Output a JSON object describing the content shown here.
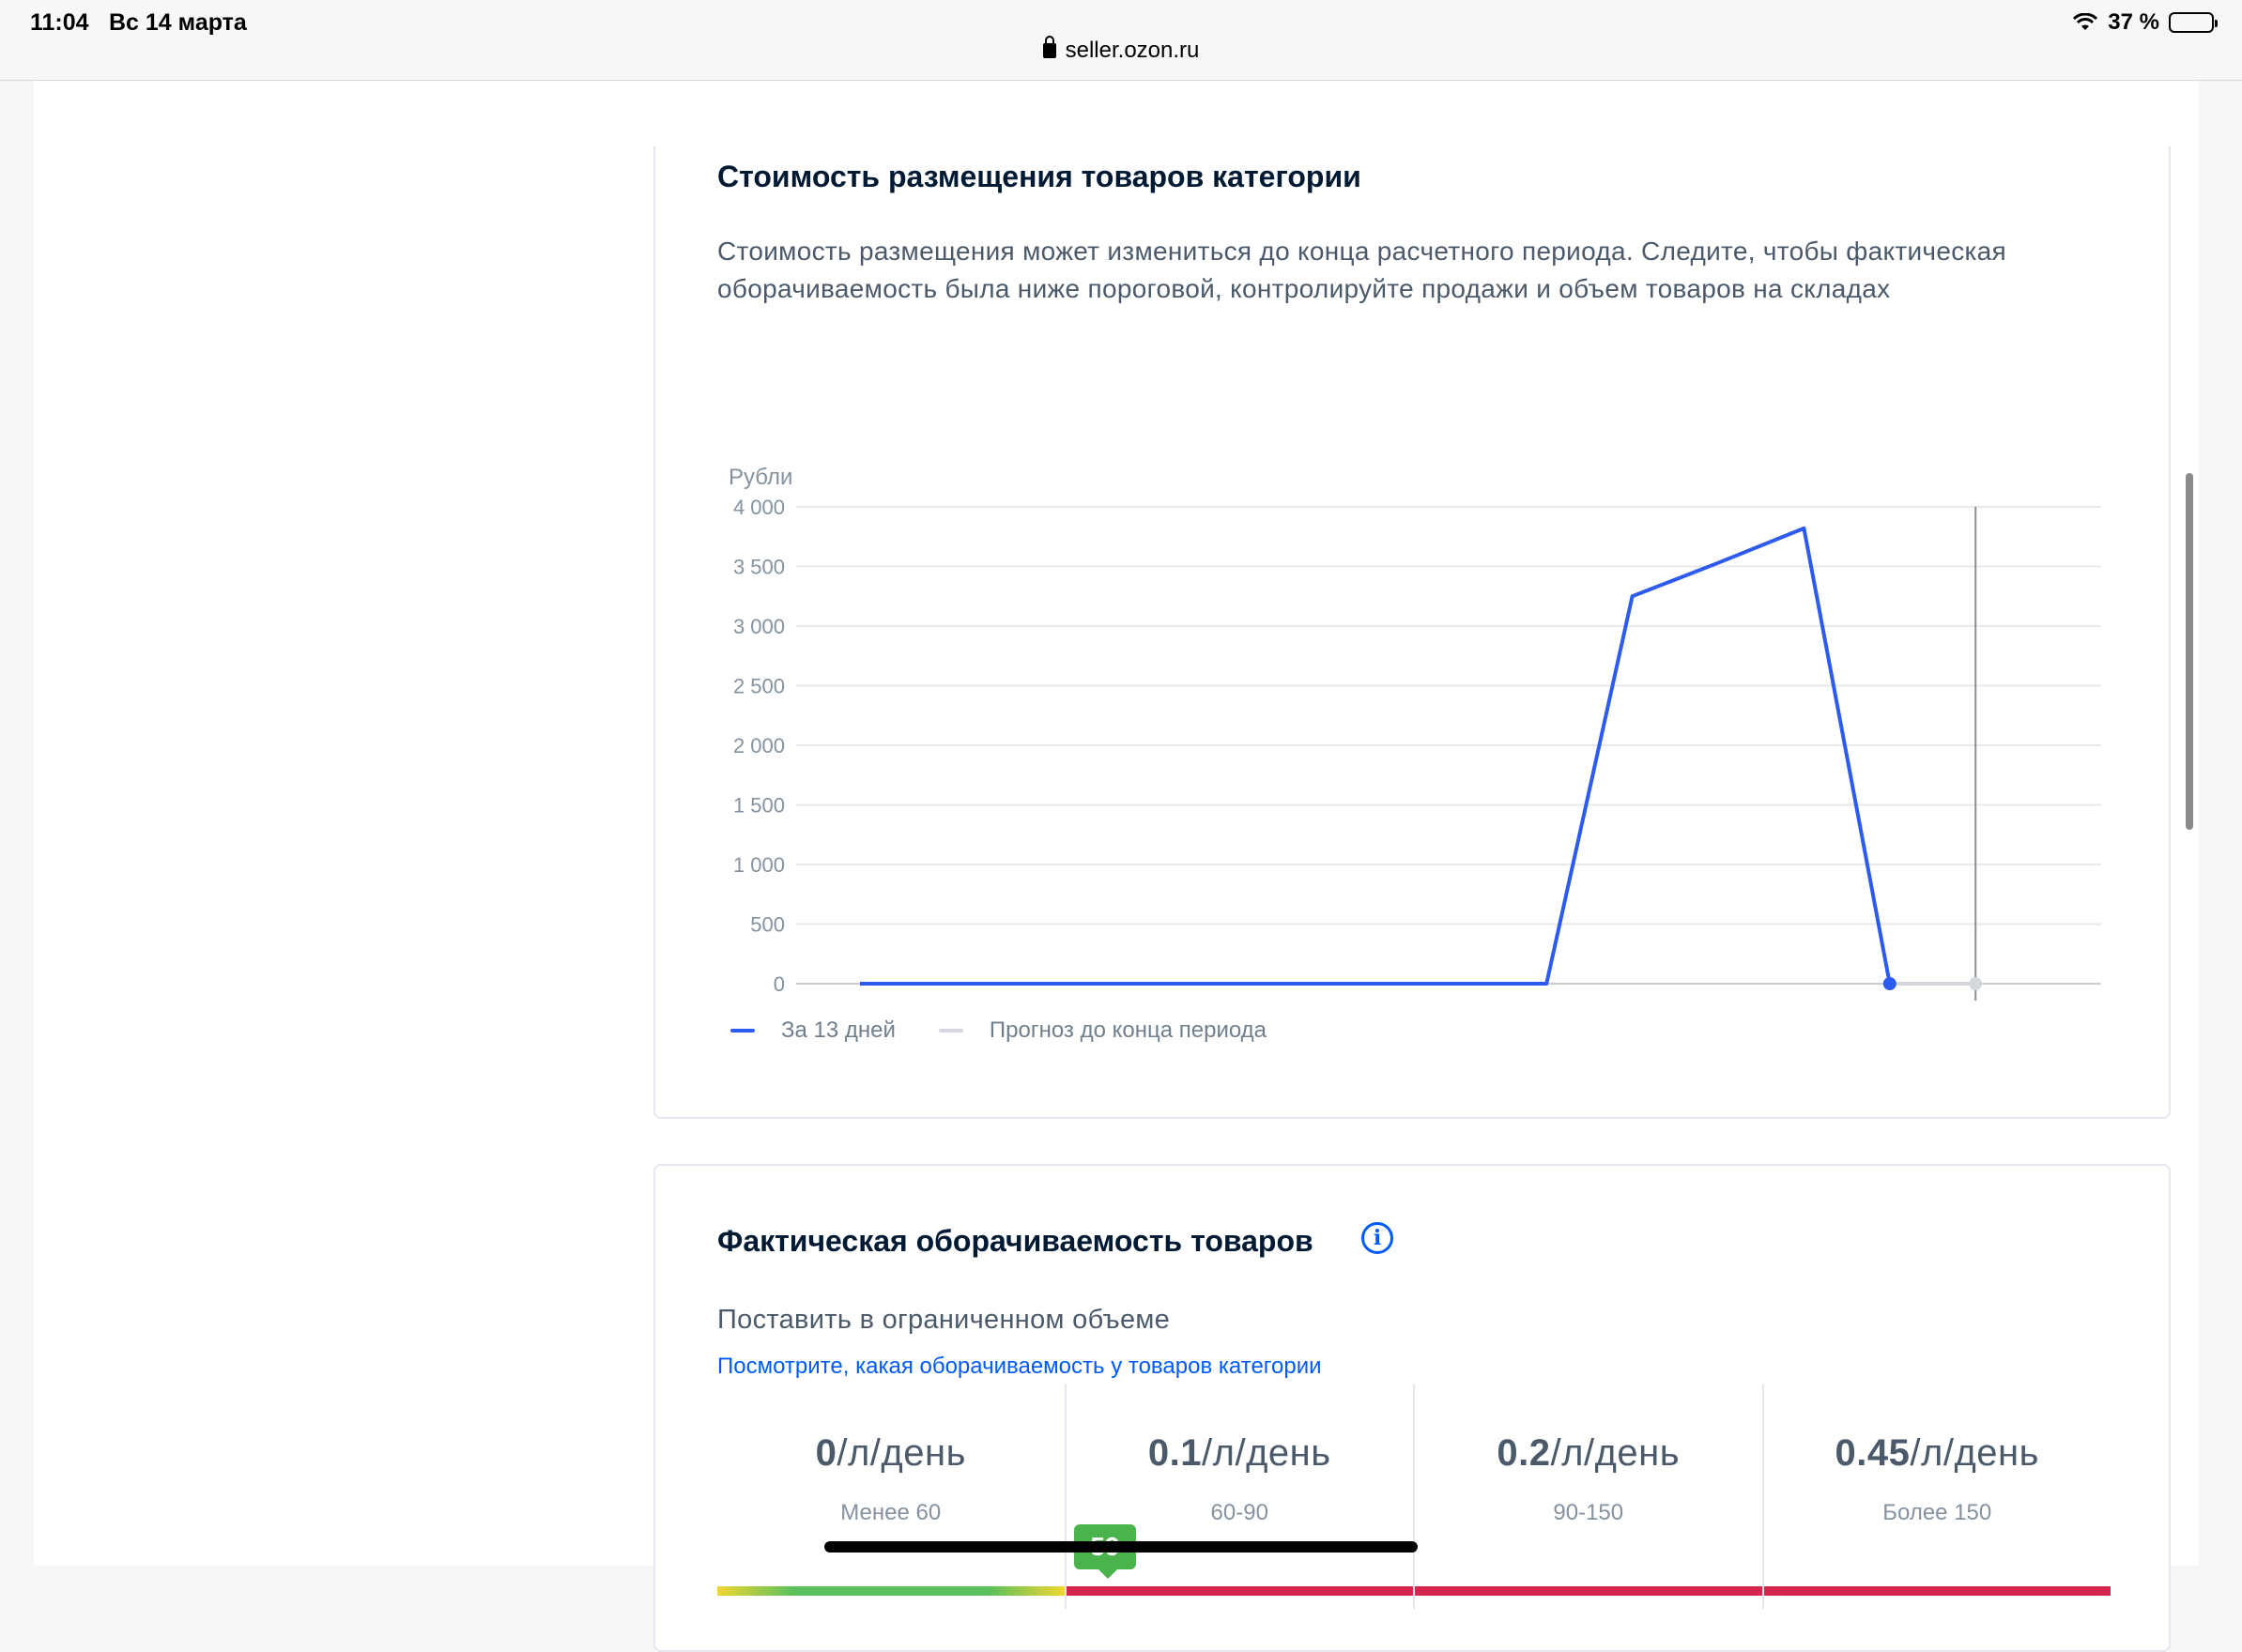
{
  "statusbar": {
    "time": "11:04",
    "date": "Вс 14 марта",
    "url": "seller.ozon.ru",
    "battery": "37 %"
  },
  "placement": {
    "title": "Стоимость размещения товаров категории",
    "description": "Стоимость размещения может измениться до конца расчетного периода. Следите, чтобы фактическая оборачиваемость была ниже пороговой, контролируйте продажи и объем товаров на складах",
    "legend": {
      "actual": "За 13 дней",
      "forecast": "Прогноз до конца периода"
    },
    "current_label": "0 ₽",
    "forecast_label": "0 ₽"
  },
  "chart_data": {
    "type": "line",
    "ylabel": "Рубли",
    "ylim": [
      0,
      4000
    ],
    "yticks": [
      0,
      500,
      1000,
      1500,
      2000,
      2500,
      3000,
      3500,
      4000
    ],
    "ytick_labels": [
      "0",
      "500",
      "1 000",
      "1 500",
      "2 000",
      "2 500",
      "3 000",
      "3 500",
      "4 000"
    ],
    "x": [
      "1",
      "2",
      "3",
      "4",
      "5",
      "6",
      "7",
      "8",
      "9",
      "10",
      "11",
      "12",
      "13",
      "14",
      "15"
    ],
    "series": [
      {
        "name": "За 13 дней",
        "color": "#2d5bef",
        "x": [
          1,
          2,
          3,
          4,
          5,
          6,
          7,
          8,
          9,
          10,
          11,
          12,
          13
        ],
        "values": [
          0,
          0,
          0,
          0,
          0,
          0,
          0,
          0,
          0,
          3250,
          3530,
          3820,
          0
        ]
      },
      {
        "name": "Прогноз до конца периода",
        "color": "#d4d8de",
        "x": [
          13,
          14
        ],
        "values": [
          0,
          0
        ]
      }
    ],
    "vline_x": 14
  },
  "turnover": {
    "title": "Фактическая оборачиваемость товаров",
    "subhead": "Поставить в ограниченном объеме",
    "link": "Посмотрите, какая оборачиваемость у товаров категории",
    "marker": "59",
    "tiers": [
      {
        "price": "0",
        "unit": "/л/день",
        "range": "Менее 60"
      },
      {
        "price": "0.1",
        "unit": "/л/день",
        "range": "60-90"
      },
      {
        "price": "0.2",
        "unit": "/л/день",
        "range": "90-150"
      },
      {
        "price": "0.45",
        "unit": "/л/день",
        "range": "Более 150"
      }
    ]
  }
}
